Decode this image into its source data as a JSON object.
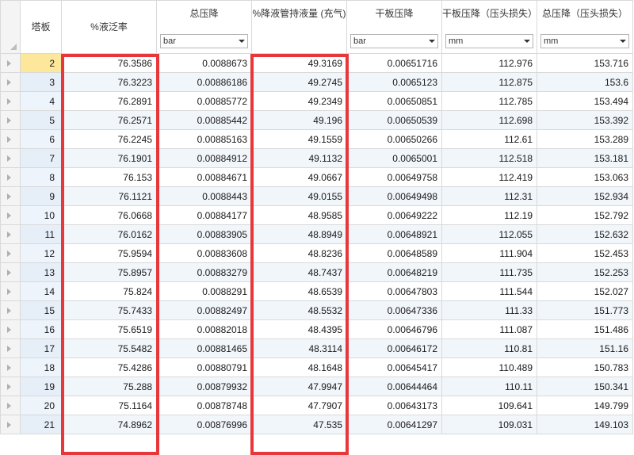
{
  "headers": {
    "stage": "塔板",
    "liquid_flooding": "%液泛率",
    "total_pressure_drop": "总压降",
    "downcomer_holdup": "%降液管持液量 (充气)",
    "dry_tray_pressure_drop": "干板压降",
    "dry_tray_head_loss": "干板压降（压头损失）",
    "total_head_loss": "总压降（压头损失）"
  },
  "units": {
    "total_pressure_drop": "bar",
    "dry_tray_pressure_drop": "bar",
    "dry_tray_head_loss": "mm",
    "total_head_loss": "mm"
  },
  "highlight_color": "#e8373a",
  "rows": [
    {
      "stage": "2",
      "flood": "76.3586",
      "dp": "0.0088673",
      "holdup": "49.3169",
      "dry_dp": "0.00651716",
      "dry_head": "112.976",
      "total_head": "153.716"
    },
    {
      "stage": "3",
      "flood": "76.3223",
      "dp": "0.00886186",
      "holdup": "49.2745",
      "dry_dp": "0.0065123",
      "dry_head": "112.875",
      "total_head": "153.6"
    },
    {
      "stage": "4",
      "flood": "76.2891",
      "dp": "0.00885772",
      "holdup": "49.2349",
      "dry_dp": "0.00650851",
      "dry_head": "112.785",
      "total_head": "153.494"
    },
    {
      "stage": "5",
      "flood": "76.2571",
      "dp": "0.00885442",
      "holdup": "49.196",
      "dry_dp": "0.00650539",
      "dry_head": "112.698",
      "total_head": "153.392"
    },
    {
      "stage": "6",
      "flood": "76.2245",
      "dp": "0.00885163",
      "holdup": "49.1559",
      "dry_dp": "0.00650266",
      "dry_head": "112.61",
      "total_head": "153.289"
    },
    {
      "stage": "7",
      "flood": "76.1901",
      "dp": "0.00884912",
      "holdup": "49.1132",
      "dry_dp": "0.0065001",
      "dry_head": "112.518",
      "total_head": "153.181"
    },
    {
      "stage": "8",
      "flood": "76.153",
      "dp": "0.00884671",
      "holdup": "49.0667",
      "dry_dp": "0.00649758",
      "dry_head": "112.419",
      "total_head": "153.063"
    },
    {
      "stage": "9",
      "flood": "76.1121",
      "dp": "0.0088443",
      "holdup": "49.0155",
      "dry_dp": "0.00649498",
      "dry_head": "112.31",
      "total_head": "152.934"
    },
    {
      "stage": "10",
      "flood": "76.0668",
      "dp": "0.00884177",
      "holdup": "48.9585",
      "dry_dp": "0.00649222",
      "dry_head": "112.19",
      "total_head": "152.792"
    },
    {
      "stage": "11",
      "flood": "76.0162",
      "dp": "0.00883905",
      "holdup": "48.8949",
      "dry_dp": "0.00648921",
      "dry_head": "112.055",
      "total_head": "152.632"
    },
    {
      "stage": "12",
      "flood": "75.9594",
      "dp": "0.00883608",
      "holdup": "48.8236",
      "dry_dp": "0.00648589",
      "dry_head": "111.904",
      "total_head": "152.453"
    },
    {
      "stage": "13",
      "flood": "75.8957",
      "dp": "0.00883279",
      "holdup": "48.7437",
      "dry_dp": "0.00648219",
      "dry_head": "111.735",
      "total_head": "152.253"
    },
    {
      "stage": "14",
      "flood": "75.824",
      "dp": "0.0088291",
      "holdup": "48.6539",
      "dry_dp": "0.00647803",
      "dry_head": "111.544",
      "total_head": "152.027"
    },
    {
      "stage": "15",
      "flood": "75.7433",
      "dp": "0.00882497",
      "holdup": "48.5532",
      "dry_dp": "0.00647336",
      "dry_head": "111.33",
      "total_head": "151.773"
    },
    {
      "stage": "16",
      "flood": "75.6519",
      "dp": "0.00882018",
      "holdup": "48.4395",
      "dry_dp": "0.00646796",
      "dry_head": "111.087",
      "total_head": "151.486"
    },
    {
      "stage": "17",
      "flood": "75.5482",
      "dp": "0.00881465",
      "holdup": "48.3114",
      "dry_dp": "0.00646172",
      "dry_head": "110.81",
      "total_head": "151.16"
    },
    {
      "stage": "18",
      "flood": "75.4286",
      "dp": "0.00880791",
      "holdup": "48.1648",
      "dry_dp": "0.00645417",
      "dry_head": "110.489",
      "total_head": "150.783"
    },
    {
      "stage": "19",
      "flood": "75.288",
      "dp": "0.00879932",
      "holdup": "47.9947",
      "dry_dp": "0.00644464",
      "dry_head": "110.11",
      "total_head": "150.341"
    },
    {
      "stage": "20",
      "flood": "75.1164",
      "dp": "0.00878748",
      "holdup": "47.7907",
      "dry_dp": "0.00643173",
      "dry_head": "109.641",
      "total_head": "149.799"
    },
    {
      "stage": "21",
      "flood": "74.8962",
      "dp": "0.00876996",
      "holdup": "47.535",
      "dry_dp": "0.00641297",
      "dry_head": "109.031",
      "total_head": "149.103"
    }
  ]
}
